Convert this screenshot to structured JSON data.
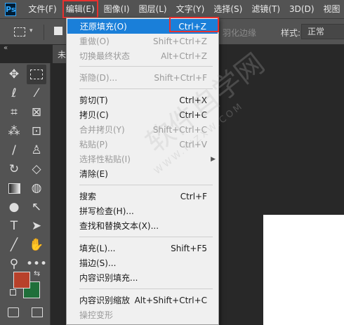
{
  "app": {
    "logo_text": "Ps"
  },
  "menubar": {
    "items": [
      "文件(F)",
      "编辑(E)",
      "图像(I)",
      "图层(L)",
      "文字(Y)",
      "选择(S)",
      "滤镜(T)",
      "3D(D)",
      "视图"
    ]
  },
  "options_bar": {
    "refine_label": "羽化边缘",
    "style_label": "样式:",
    "style_value": "正常"
  },
  "tabs": {
    "collapse": "«",
    "doc_tab": "未"
  },
  "colors": {
    "foreground": "#b8412b",
    "background": "#1f6f3a",
    "menu_highlight": "#1a7fd9"
  },
  "edit_menu": {
    "items": [
      {
        "label": "还原填充(O)",
        "shortcut": "Ctrl+Z"
      },
      {
        "label": "重做(O)",
        "shortcut": "Shift+Ctrl+Z"
      },
      {
        "label": "切换最终状态",
        "shortcut": "Alt+Ctrl+Z"
      },
      {
        "label": "渐隐(D)...",
        "shortcut": "Shift+Ctrl+F"
      },
      {
        "label": "剪切(T)",
        "shortcut": "Ctrl+X"
      },
      {
        "label": "拷贝(C)",
        "shortcut": "Ctrl+C"
      },
      {
        "label": "合并拷贝(Y)",
        "shortcut": "Shift+Ctrl+C"
      },
      {
        "label": "粘贴(P)",
        "shortcut": "Ctrl+V"
      },
      {
        "label": "选择性粘贴(I)",
        "shortcut": ""
      },
      {
        "label": "清除(E)",
        "shortcut": ""
      },
      {
        "label": "搜索",
        "shortcut": "Ctrl+F"
      },
      {
        "label": "拼写检查(H)...",
        "shortcut": ""
      },
      {
        "label": "查找和替换文本(X)...",
        "shortcut": ""
      },
      {
        "label": "填充(L)...",
        "shortcut": "Shift+F5"
      },
      {
        "label": "描边(S)...",
        "shortcut": ""
      },
      {
        "label": "内容识别填充...",
        "shortcut": ""
      },
      {
        "label": "内容识别缩放",
        "shortcut": "Alt+Shift+Ctrl+C"
      },
      {
        "label": "操控变形",
        "shortcut": ""
      }
    ]
  },
  "watermark": {
    "text": "软件自学网",
    "sub": "WWW.RJZXW.COM"
  }
}
